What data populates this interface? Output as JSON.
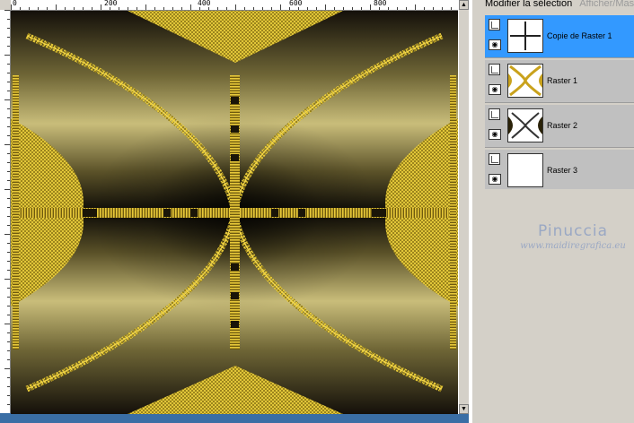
{
  "canvas": {
    "ruler_labels": [
      "0",
      "200",
      "400",
      "600",
      "800"
    ],
    "scroll_arrows": {
      "up": "▲",
      "down": "▼"
    }
  },
  "layers_panel": {
    "tabs": {
      "active": "Modifier la sélection",
      "inactive": "Afficher/Mas"
    },
    "eye_glyph": "◉",
    "layers": [
      {
        "name": "Copie de Raster 1",
        "selected": true
      },
      {
        "name": "Raster 1",
        "selected": false
      },
      {
        "name": "Raster 2",
        "selected": false
      },
      {
        "name": "Raster 3",
        "selected": false
      }
    ]
  },
  "watermark": {
    "name": "Pinuccia",
    "url": "www.maidiregrafica.eu"
  },
  "colors": {
    "gold": "#d8b52a",
    "selection_blue": "#3399ff",
    "workspace_blue": "#3a6ea5",
    "panel_gray": "#d4d0c8"
  }
}
